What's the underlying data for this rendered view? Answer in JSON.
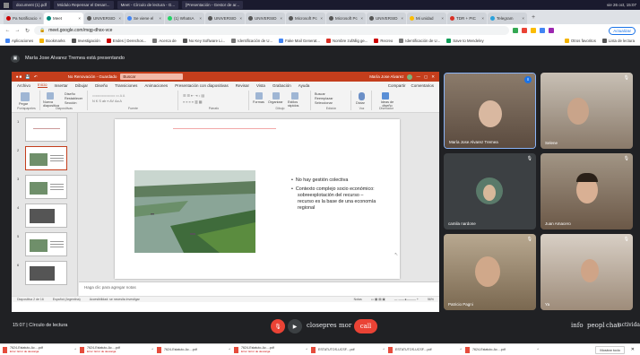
{
  "os": {
    "tasks": [
      "document (1).pdf",
      "Módulo Repensar el Desarr...",
      "Meet - Círculo de lectura - G...",
      "[Presentación - Gestor de ar..."
    ],
    "time": "vie 26 oct, 15:07"
  },
  "browser": {
    "tabs": [
      {
        "label": "Pa Notificacio",
        "color": "#c00"
      },
      {
        "label": "Meet",
        "color": "#00897b"
      },
      {
        "label": "UNIVERSID",
        "color": "#555"
      },
      {
        "label": "Se viene el",
        "color": "#4285f4"
      },
      {
        "label": "(1) WhatsA",
        "color": "#25d366"
      },
      {
        "label": "UNIVERSID",
        "color": "#555"
      },
      {
        "label": "UNIVERSID",
        "color": "#555"
      },
      {
        "label": "Microsoft Pc",
        "color": "#555"
      },
      {
        "label": "Microsoft Pc",
        "color": "#555"
      },
      {
        "label": "UNIVERSID",
        "color": "#555"
      },
      {
        "label": "Mi unidad",
        "color": "#fbbc04"
      },
      {
        "label": "TDR + PIC",
        "color": "#d93025"
      },
      {
        "label": "Telegram",
        "color": "#2aa1da"
      }
    ],
    "url": "meet.google.com/mqg-dhsx-vce",
    "update_label": "Actualizar",
    "bookmarks": [
      "Aplicaciones",
      "Bookmarks",
      "Investigación",
      "Endes | Derechos...",
      "Acerca de",
      "No Key Software Li...",
      "Identificación de U...",
      "Fake Mail Generat...",
      "Nombre zufällig ge...",
      "Recreo",
      "Identificación de U...",
      "Save to Mendeley",
      "Otros favoritos",
      "Lista de lectura"
    ]
  },
  "meet": {
    "presenting": "María Jose Alvarez Tremea está presentando",
    "meeting_info": "15:07  |  Círculo de lectura",
    "tiles": [
      {
        "name": "María Jose Alvarez Tremea",
        "color": "#6b5a4e"
      },
      {
        "name": "Selene",
        "color": "#7a6a58"
      },
      {
        "name": "camila nardone",
        "color": "#3c4043"
      },
      {
        "name": "Juan Amacero",
        "color": "#6b5847"
      },
      {
        "name": "Patricio Pagni",
        "color": "#8b7a63"
      },
      {
        "name": "Ya",
        "color": "#8f7e6e"
      }
    ],
    "right_texts": [
      "info",
      "peopl",
      "chat",
      "actividad"
    ],
    "bar_texts": [
      "close",
      "pres",
      "mor",
      "call"
    ]
  },
  "ppt": {
    "file": "No Renovación - Guardado",
    "search": "Buscar",
    "user": "María Jose Alvarez",
    "menu": [
      "Archivo",
      "Inicio",
      "Insertar",
      "Dibujar",
      "Diseño",
      "Transiciones",
      "Animaciones",
      "Presentación con diapositivas",
      "Revisar",
      "Vista",
      "Grabación",
      "Ayuda"
    ],
    "share": "Compartir",
    "comments": "Comentarios",
    "ribbon_groups": [
      "Portapapeles",
      "Diapositivas",
      "Fuente",
      "Párrafo",
      "Dibujo",
      "Edición",
      "Voz",
      "Diseñador"
    ],
    "ribbon_labels": [
      "Pegar",
      "Nueva diapositiva",
      "Diseño",
      "Restablecer",
      "Sección",
      "Formas",
      "Organizar",
      "Estilos rápidos",
      "Buscar",
      "Reemplazar",
      "Seleccionar",
      "Dictar",
      "Ideas de diseño"
    ],
    "slide_numbers": [
      "1",
      "2",
      "3",
      "4",
      "5",
      "6"
    ],
    "bullets": [
      "No hay gestión colectiva",
      "Contexto complejo socio económico: sobreexplotación del recurso – recurso es la base de una economía regional"
    ],
    "notes_placeholder": "Haga clic para agregar notas",
    "status": [
      "Diapositiva 2 de 16",
      "Español (Argentina)",
      "Accesibilidad: se necesita investigar",
      "Notas",
      "56%"
    ]
  },
  "downloads": {
    "items": [
      {
        "name": "7624-Estatuto-Ac....pdf",
        "sub": "Error: Error de descarga"
      },
      {
        "name": "7624-Estatuto-Ac....pdf",
        "sub": "Error: Error de descarga"
      },
      {
        "name": "7624-Estatuto-Ac....pdf",
        "sub": ""
      },
      {
        "name": "7624-Estatuto-Ac....pdf",
        "sub": "Error: Error de descarga"
      },
      {
        "name": "ESTATUTOS-UCSF....pdf",
        "sub": ""
      },
      {
        "name": "ESTATUTOS-UCSF....pdf",
        "sub": ""
      },
      {
        "name": "7624-Estatuto-Ac....pdf",
        "sub": ""
      }
    ],
    "show_all": "Mostrar todo"
  }
}
